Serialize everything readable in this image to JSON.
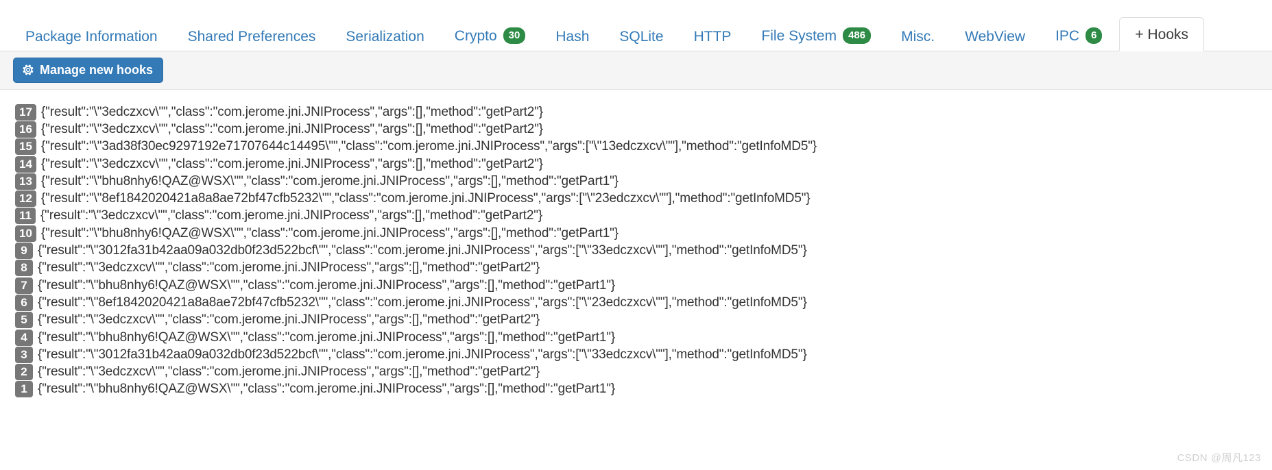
{
  "tabs": [
    {
      "label": "Package Information",
      "badge": null,
      "active": false
    },
    {
      "label": "Shared Preferences",
      "badge": null,
      "active": false
    },
    {
      "label": "Serialization",
      "badge": null,
      "active": false
    },
    {
      "label": "Crypto",
      "badge": "30",
      "active": false
    },
    {
      "label": "Hash",
      "badge": null,
      "active": false
    },
    {
      "label": "SQLite",
      "badge": null,
      "active": false
    },
    {
      "label": "HTTP",
      "badge": null,
      "active": false
    },
    {
      "label": "File System",
      "badge": "486",
      "active": false
    },
    {
      "label": "Misc.",
      "badge": null,
      "active": false
    },
    {
      "label": "WebView",
      "badge": null,
      "active": false
    },
    {
      "label": "IPC",
      "badge": "6",
      "active": false
    },
    {
      "label": "+ Hooks",
      "badge": null,
      "active": true
    }
  ],
  "toolbar": {
    "manage_hooks_label": "Manage new hooks",
    "gear_icon": "gear-icon"
  },
  "log": {
    "lines": [
      {
        "no": "17",
        "text": "{\"result\":\"\\\"3edczxcv\\\"\",\"class\":\"com.jerome.jni.JNIProcess\",\"args\":[],\"method\":\"getPart2\"}"
      },
      {
        "no": "16",
        "text": "{\"result\":\"\\\"3edczxcv\\\"\",\"class\":\"com.jerome.jni.JNIProcess\",\"args\":[],\"method\":\"getPart2\"}"
      },
      {
        "no": "15",
        "text": "{\"result\":\"\\\"3ad38f30ec9297192e71707644c14495\\\"\",\"class\":\"com.jerome.jni.JNIProcess\",\"args\":[\"\\\"13edczxcv\\\"\"],\"method\":\"getInfoMD5\"}"
      },
      {
        "no": "14",
        "text": "{\"result\":\"\\\"3edczxcv\\\"\",\"class\":\"com.jerome.jni.JNIProcess\",\"args\":[],\"method\":\"getPart2\"}"
      },
      {
        "no": "13",
        "text": "{\"result\":\"\\\"bhu8nhy6!QAZ@WSX\\\"\",\"class\":\"com.jerome.jni.JNIProcess\",\"args\":[],\"method\":\"getPart1\"}"
      },
      {
        "no": "12",
        "text": "{\"result\":\"\\\"8ef1842020421a8a8ae72bf47cfb5232\\\"\",\"class\":\"com.jerome.jni.JNIProcess\",\"args\":[\"\\\"23edczxcv\\\"\"],\"method\":\"getInfoMD5\"}"
      },
      {
        "no": "11",
        "text": "{\"result\":\"\\\"3edczxcv\\\"\",\"class\":\"com.jerome.jni.JNIProcess\",\"args\":[],\"method\":\"getPart2\"}"
      },
      {
        "no": "10",
        "text": "{\"result\":\"\\\"bhu8nhy6!QAZ@WSX\\\"\",\"class\":\"com.jerome.jni.JNIProcess\",\"args\":[],\"method\":\"getPart1\"}"
      },
      {
        "no": "9",
        "text": "{\"result\":\"\\\"3012fa31b42aa09a032db0f23d522bcf\\\"\",\"class\":\"com.jerome.jni.JNIProcess\",\"args\":[\"\\\"33edczxcv\\\"\"],\"method\":\"getInfoMD5\"}"
      },
      {
        "no": "8",
        "text": "{\"result\":\"\\\"3edczxcv\\\"\",\"class\":\"com.jerome.jni.JNIProcess\",\"args\":[],\"method\":\"getPart2\"}"
      },
      {
        "no": "7",
        "text": "{\"result\":\"\\\"bhu8nhy6!QAZ@WSX\\\"\",\"class\":\"com.jerome.jni.JNIProcess\",\"args\":[],\"method\":\"getPart1\"}"
      },
      {
        "no": "6",
        "text": "{\"result\":\"\\\"8ef1842020421a8a8ae72bf47cfb5232\\\"\",\"class\":\"com.jerome.jni.JNIProcess\",\"args\":[\"\\\"23edczxcv\\\"\"],\"method\":\"getInfoMD5\"}"
      },
      {
        "no": "5",
        "text": "{\"result\":\"\\\"3edczxcv\\\"\",\"class\":\"com.jerome.jni.JNIProcess\",\"args\":[],\"method\":\"getPart2\"}"
      },
      {
        "no": "4",
        "text": "{\"result\":\"\\\"bhu8nhy6!QAZ@WSX\\\"\",\"class\":\"com.jerome.jni.JNIProcess\",\"args\":[],\"method\":\"getPart1\"}"
      },
      {
        "no": "3",
        "text": "{\"result\":\"\\\"3012fa31b42aa09a032db0f23d522bcf\\\"\",\"class\":\"com.jerome.jni.JNIProcess\",\"args\":[\"\\\"33edczxcv\\\"\"],\"method\":\"getInfoMD5\"}"
      },
      {
        "no": "2",
        "text": "{\"result\":\"\\\"3edczxcv\\\"\",\"class\":\"com.jerome.jni.JNIProcess\",\"args\":[],\"method\":\"getPart2\"}"
      },
      {
        "no": "1",
        "text": "{\"result\":\"\\\"bhu8nhy6!QAZ@WSX\\\"\",\"class\":\"com.jerome.jni.JNIProcess\",\"args\":[],\"method\":\"getPart1\"}"
      }
    ]
  },
  "watermark": {
    "text": "CSDN @周凡123"
  },
  "colors": {
    "link": "#337ab7",
    "badge_green": "#2e8b45",
    "button_blue": "#337ab7",
    "lineno_gray": "#777777",
    "toolbar_bg": "#f5f5f5"
  }
}
